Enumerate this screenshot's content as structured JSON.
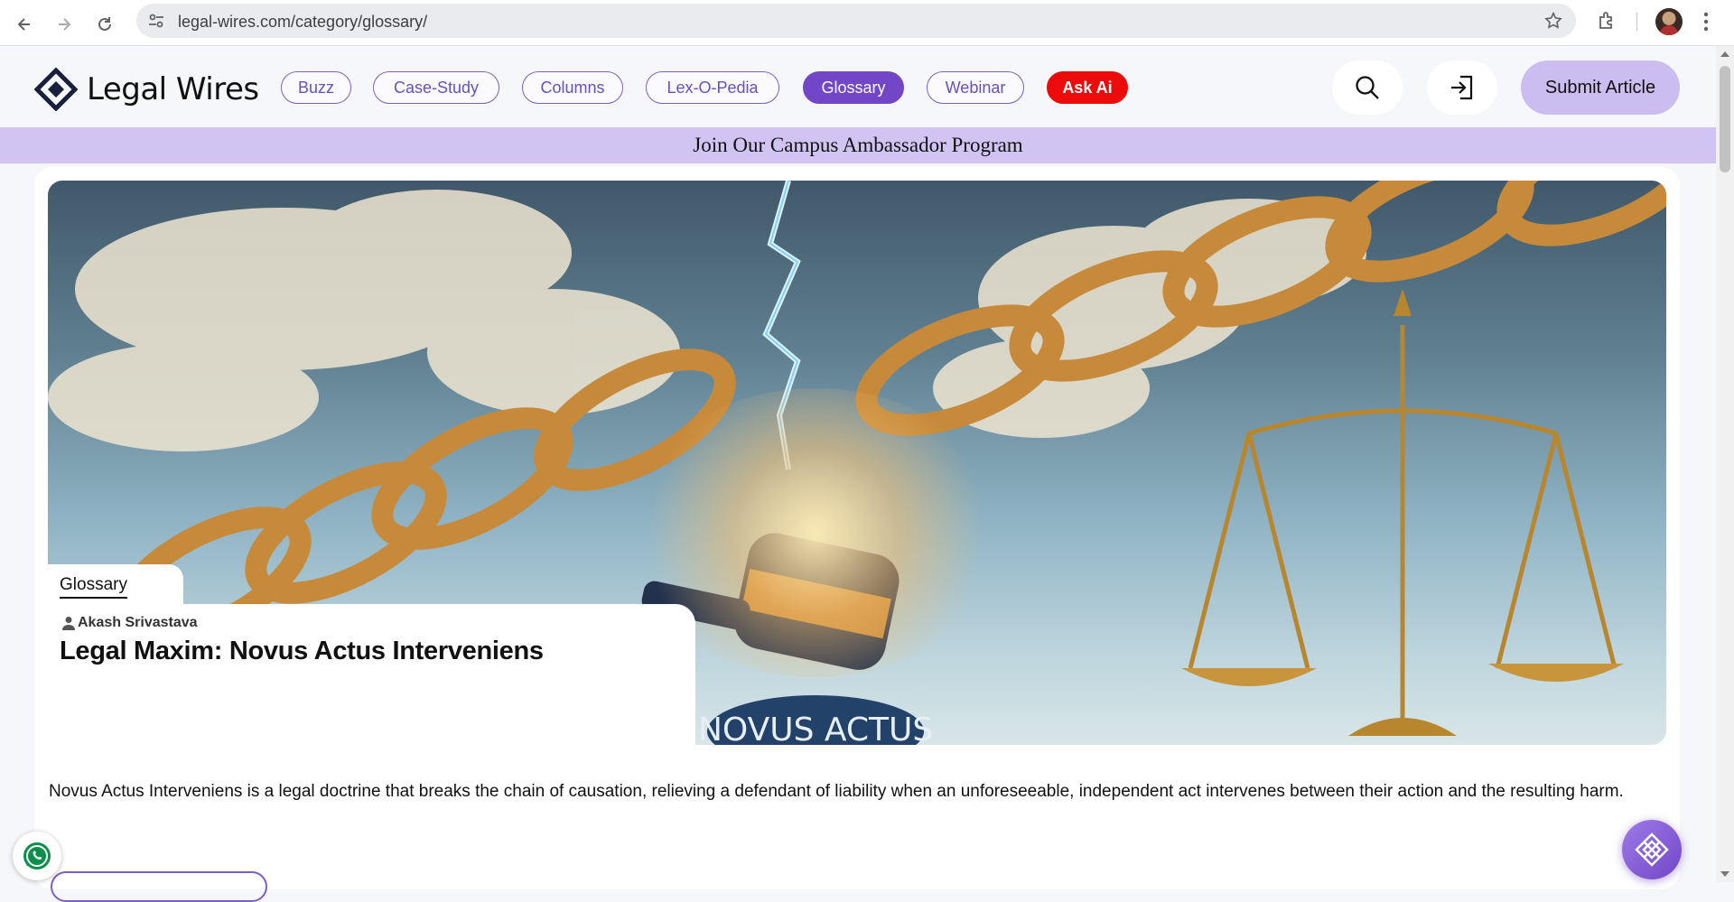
{
  "browser": {
    "url": "legal-wires.com/category/glossary/",
    "icons": [
      "back-icon",
      "forward-icon",
      "reload-icon",
      "site-info-icon",
      "bookmark-star-icon",
      "extensions-icon",
      "profile-avatar",
      "more-menu-icon"
    ]
  },
  "site": {
    "logo_text": "Legal Wires",
    "nav": [
      {
        "label": "Buzz",
        "active": false
      },
      {
        "label": "Case-Study",
        "active": false
      },
      {
        "label": "Columns",
        "active": false
      },
      {
        "label": "Lex-O-Pedia",
        "active": false
      },
      {
        "label": "Glossary",
        "active": true
      },
      {
        "label": "Webinar",
        "active": false
      },
      {
        "label": "Ask Ai",
        "active": false
      }
    ],
    "submit_label": "Submit Article",
    "banner_text": "Join Our Campus Ambassador Program"
  },
  "article": {
    "category": "Glossary",
    "author": "Akash Srivastava",
    "title": "Legal Maxim: Novus Actus Interveniens",
    "image_caption": "NOVUS ACTUS",
    "excerpt": "Novus Actus Interveniens is a legal doctrine that breaks the chain of causation, relieving a defendant of liability when an unforeseeable, independent act intervenes between their action and the resulting harm."
  },
  "colors": {
    "accent": "#7346c7",
    "banner": "#d1c4f3",
    "ask_ai": "#ec0b0b",
    "whatsapp": "#25d366"
  }
}
